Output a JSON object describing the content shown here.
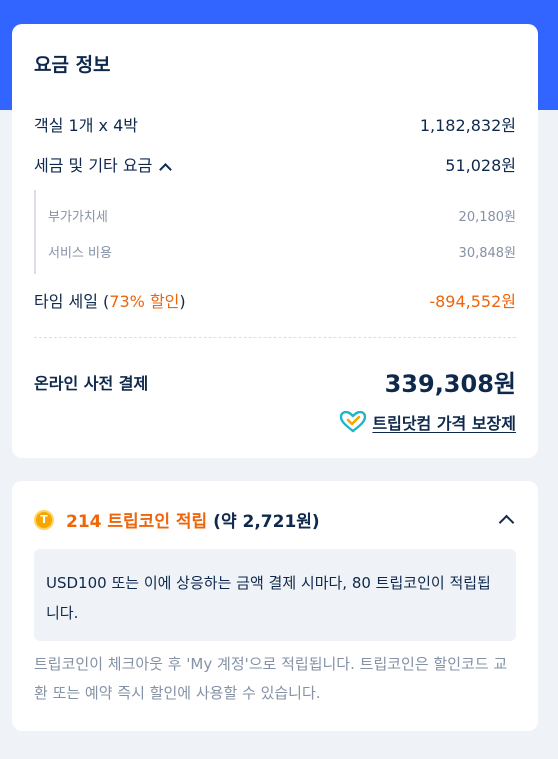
{
  "price_info": {
    "title": "요금 정보",
    "room_label": "객실 1개 x 4박",
    "room_value": "1,182,832원",
    "tax_label": "세금 및 기타 요금",
    "tax_value": "51,028원",
    "tax_items": [
      {
        "label": "부가가치세",
        "value": "20,180원"
      },
      {
        "label": "서비스 비용",
        "value": "30,848원"
      }
    ],
    "sale_label_pre": "타임 세일 (",
    "sale_pct": "73% 할인",
    "sale_label_post": ")",
    "sale_value": "-894,552원",
    "total_label": "온라인 사전 결제",
    "total_value": "339,308원",
    "guarantee_label": "트립닷컴 가격 보장제"
  },
  "trip_coin": {
    "coin_symbol": "T",
    "title": "214 트립코인 적립",
    "approx": "(약 2,721원)",
    "info": "USD100 또는 이에 상응하는 금액 결제 시마다, 80 트립코인이 적립됩니다.",
    "note": "트립코인이 체크아웃 후 'My 계정'으로 적립됩니다. 트립코인은 할인코드 교환 또는 예약 즉시 할인에 사용할 수 있습니다."
  },
  "colors": {
    "brand_blue": "#3264ff",
    "accent_orange": "#f0640a",
    "text_dark": "#0f294d",
    "text_muted": "#8592a6",
    "coin_gold": "#f7a600",
    "guarantee_icon_teal": "#1fb6c9"
  },
  "icons": {
    "tax_toggle": "chevron-up-icon",
    "guarantee": "heart-check-icon",
    "coin": "coin-icon",
    "coin_toggle": "chevron-up-icon"
  }
}
